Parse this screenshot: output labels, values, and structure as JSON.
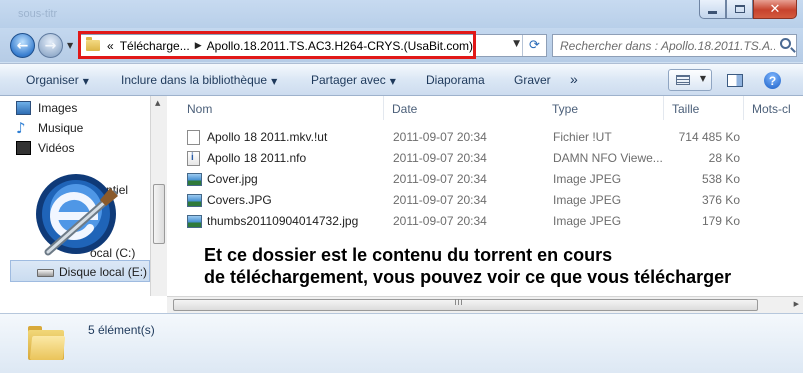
{
  "window": {
    "title": "",
    "ghost_title": "sous-titr",
    "buttons": [
      "minimize",
      "maximize",
      "close"
    ]
  },
  "nav": {
    "address_prefix": "«",
    "crumbs": [
      "Télécharge...",
      "Apollo.18.2011.TS.AC3.H264-CRYS.(UsaBit.com)"
    ],
    "crumb_separator": "▶",
    "search_placeholder": "Rechercher dans : Apollo.18.2011.TS.A..."
  },
  "toolbar": {
    "organiser": "Organiser",
    "inclure": "Inclure dans la bibliothèque",
    "partager": "Partager avec",
    "diaporama": "Diaporama",
    "graver": "Graver",
    "more": "»",
    "help": "?"
  },
  "navpane": {
    "items": [
      "Images",
      "Musique",
      "Vidéos",
      "identiel",
      "ocal (C:)",
      "Disque local (E:)"
    ]
  },
  "columns": {
    "name": "Nom",
    "date": "Date",
    "type": "Type",
    "size": "Taille",
    "tags": "Mots-cl"
  },
  "files": [
    {
      "name": "Apollo 18 2011.mkv.!ut",
      "date": "2011-09-07 20:34",
      "type": "Fichier !UT",
      "size": "714 485 Ko",
      "icon": "file-icon"
    },
    {
      "name": "Apollo 18 2011.nfo",
      "date": "2011-09-07 20:34",
      "type": "DAMN NFO Viewe...",
      "size": "28 Ko",
      "icon": "nfo-icon"
    },
    {
      "name": "Cover.jpg",
      "date": "2011-09-07 20:34",
      "type": "Image JPEG",
      "size": "538 Ko",
      "icon": "image-icon"
    },
    {
      "name": "Covers.JPG",
      "date": "2011-09-07 20:34",
      "type": "Image JPEG",
      "size": "376 Ko",
      "icon": "image-icon"
    },
    {
      "name": "thumbs20110904014732.jpg",
      "date": "2011-09-07 20:34",
      "type": "Image JPEG",
      "size": "179 Ko",
      "icon": "image-icon"
    }
  ],
  "overlay_text": {
    "line1": "Et ce dossier est le contenu du torrent en cours",
    "line2": "de téléchargement, vous pouvez voir ce que vous télécharger"
  },
  "details": {
    "count": "5 élément(s)"
  },
  "colors": {
    "highlight_box": "#e11818",
    "window_frame": "#c4d8ef"
  }
}
